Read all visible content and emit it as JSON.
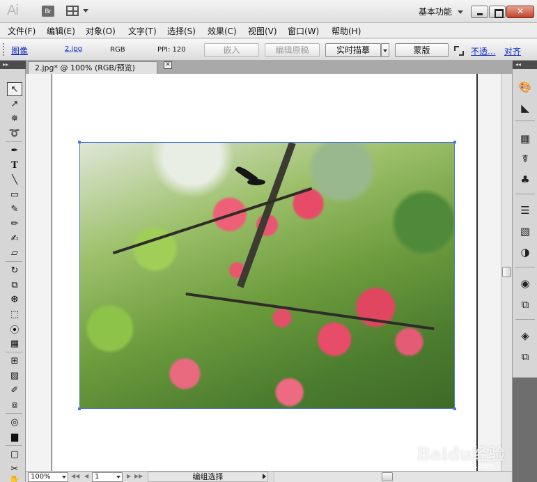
{
  "titlebar": {
    "app_logo": "Ai",
    "bridge_label": "Br",
    "workspace": "基本功能"
  },
  "menu": {
    "items": [
      {
        "label": "文件(F)"
      },
      {
        "label": "编辑(E)"
      },
      {
        "label": "对象(O)"
      },
      {
        "label": "文字(T)"
      },
      {
        "label": "选择(S)"
      },
      {
        "label": "效果(C)"
      },
      {
        "label": "视图(V)"
      },
      {
        "label": "窗口(W)"
      },
      {
        "label": "帮助(H)"
      }
    ]
  },
  "control_bar": {
    "object_type": "图像",
    "file_name": "2.jpg",
    "color_mode": "RGB",
    "ppi": "PPI: 120",
    "embed_label": "嵌入",
    "edit_original_label": "编辑原稿",
    "live_trace_label": "实时描摹",
    "mask_label": "蒙版",
    "opacity_link": "不透...",
    "align_link": "对齐"
  },
  "document": {
    "tab_title": "2.jpg* @ 100% (RGB/预览)",
    "tab_close": "✕"
  },
  "statusbar": {
    "zoom": "100%",
    "artboard": "1",
    "status_text": "编组选择",
    "nav_first": "◀◀",
    "nav_prev": "◀",
    "nav_next": "▶",
    "nav_last": "▶▶"
  },
  "watermark": {
    "brand": "Baidu经验",
    "site": "jingyan.baidu.com"
  },
  "icons": {
    "tools": [
      "selection-tool-icon",
      "direct-selection-tool-icon",
      "magic-wand-tool-icon",
      "lasso-tool-icon",
      "pen-tool-icon",
      "type-tool-icon",
      "line-tool-icon",
      "rectangle-tool-icon",
      "paintbrush-tool-icon",
      "pencil-tool-icon",
      "blob-brush-tool-icon",
      "eraser-tool-icon",
      "rotate-tool-icon",
      "scale-tool-icon",
      "warp-tool-icon",
      "free-transform-tool-icon",
      "shape-builder-tool-icon",
      "perspective-grid-tool-icon",
      "mesh-tool-icon",
      "gradient-tool-icon",
      "eyedropper-tool-icon",
      "blend-tool-icon",
      "symbol-sprayer-tool-icon",
      "column-graph-tool-icon",
      "artboard-tool-icon",
      "slice-tool-icon",
      "hand-tool-icon"
    ],
    "dock": [
      "color-panel-icon",
      "color-guide-icon",
      "swatches-icon",
      "brushes-icon",
      "symbols-icon",
      "stroke-icon",
      "gradient-panel-icon",
      "transparency-icon",
      "appearance-icon",
      "graphic-styles-icon",
      "layers-icon",
      "artboards-icon"
    ]
  },
  "colors": {
    "link": "#0a28c8",
    "selection": "#4a77d8",
    "close_button": "#c2402a"
  }
}
